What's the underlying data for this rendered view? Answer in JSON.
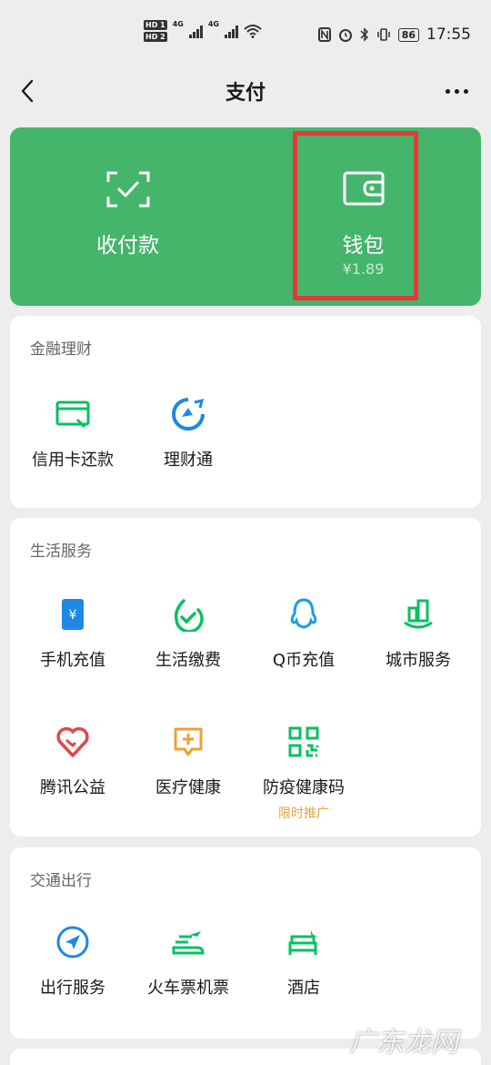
{
  "status_bar": {
    "hd1": "HD 1",
    "hd2": "HD 2",
    "net1": "4G",
    "net2": "4G",
    "battery": "86",
    "time": "17:55"
  },
  "nav": {
    "title": "支付",
    "back_icon": "chevron-left-icon",
    "more_icon": "more-horizontal-icon"
  },
  "top_card": {
    "collect_label": "收付款",
    "wallet_label": "钱包",
    "wallet_balance": "¥1.89",
    "bg_color": "#45b56c",
    "highlight_color": "#e53935"
  },
  "finance": {
    "title": "金融理财",
    "items": [
      {
        "label": "信用卡还款",
        "icon": "credit-card-icon"
      },
      {
        "label": "理财通",
        "icon": "wealth-icon"
      }
    ]
  },
  "life": {
    "title": "生活服务",
    "items": [
      {
        "label": "手机充值",
        "icon": "phone-recharge-icon"
      },
      {
        "label": "生活缴费",
        "icon": "utility-payment-icon"
      },
      {
        "label": "Q币充值",
        "icon": "qq-coin-icon"
      },
      {
        "label": "城市服务",
        "icon": "city-service-icon"
      },
      {
        "label": "腾讯公益",
        "icon": "charity-heart-icon"
      },
      {
        "label": "医疗健康",
        "icon": "medical-icon"
      },
      {
        "label": "防疫健康码",
        "icon": "qr-code-icon",
        "promo": "限时推广"
      }
    ]
  },
  "transport": {
    "title": "交通出行",
    "items": [
      {
        "label": "出行服务",
        "icon": "navigation-icon"
      },
      {
        "label": "火车票机票",
        "icon": "train-plane-icon"
      },
      {
        "label": "酒店",
        "icon": "hotel-bed-icon"
      }
    ]
  },
  "watermark": "广东龙网"
}
